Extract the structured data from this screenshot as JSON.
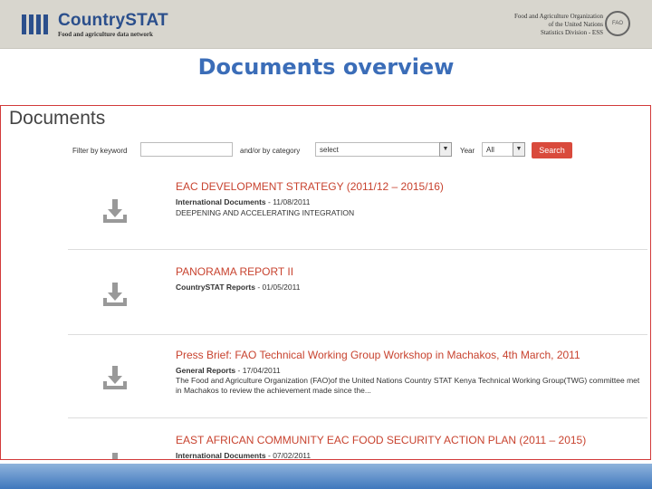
{
  "banner": {
    "brand_title": "CountrySTAT",
    "brand_subtitle": "Food and agriculture data network",
    "org_line1": "Food and Agriculture Organization",
    "org_line2": "of the United Nations",
    "org_line3": "Statistics Division - ESS",
    "seal_text": "FAO"
  },
  "slide_title": "Documents overview",
  "documents_page": {
    "heading": "Documents",
    "filter": {
      "keyword_label": "Filter by keyword",
      "keyword_value": "",
      "category_label": "and/or by category",
      "category_value": "select",
      "year_label": "Year",
      "year_value": "All",
      "search_label": "Search"
    },
    "items": [
      {
        "title": "EAC DEVELOPMENT STRATEGY (2011/12 – 2015/16)",
        "category": "International Documents",
        "date": " - 11/08/2011",
        "desc": "DEEPENING AND ACCELERATING INTEGRATION"
      },
      {
        "title": "PANORAMA REPORT II",
        "category": "CountrySTAT Reports",
        "date": " - 01/05/2011",
        "desc": ""
      },
      {
        "title": "Press Brief: FAO Technical Working Group Workshop in Machakos, 4th March, 2011",
        "category": "General Reports",
        "date": " - 17/04/2011",
        "desc": "The Food and Agriculture Organization (FAO)of the United Nations Country STAT Kenya Technical Working Group(TWG) committee met in Machakos to review the achievement made since the..."
      },
      {
        "title": "EAST AFRICAN COMMUNITY EAC FOOD SECURITY ACTION PLAN (2011 – 2015)",
        "category": "International Documents",
        "date": " - 07/02/2011",
        "desc": ""
      }
    ]
  },
  "icons": {
    "download": "download-tray-icon",
    "dropdown": "chevron-down-icon"
  },
  "colors": {
    "brand_blue": "#2b4f8c",
    "title_blue": "#3b6db8",
    "doc_title_red": "#c8432f",
    "search_red": "#d94a3c",
    "frame_red": "#d23a3a"
  }
}
